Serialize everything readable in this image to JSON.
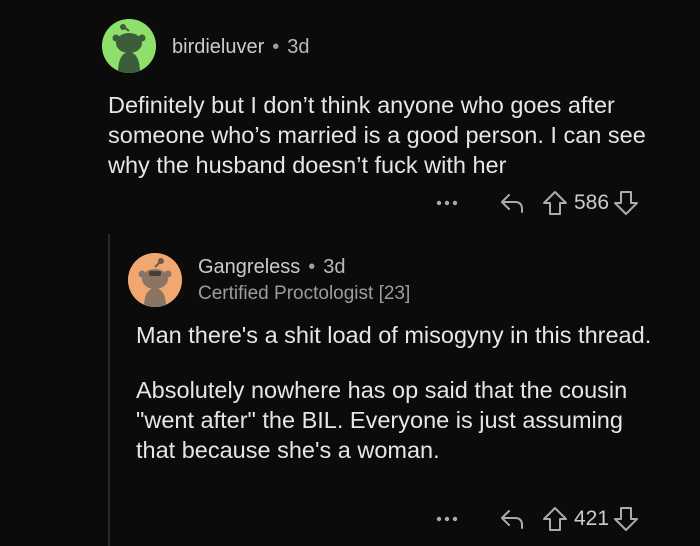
{
  "comments": [
    {
      "username": "birdieluver",
      "age": "3d",
      "flair": "",
      "paragraphs": [
        "Definitely but I don’t think anyone who goes after someone who’s married is a good person. I can see why the husband doesn’t fuck with her"
      ],
      "score": "586",
      "avatar_color": "#8ee06a",
      "more_icon": "more-dots-icon",
      "reply_icon": "reply-arrow-icon",
      "upvote_icon": "upvote-arrow-icon",
      "downvote_icon": "downvote-arrow-icon"
    },
    {
      "username": "Gangreless",
      "age": "3d",
      "flair": "Certified Proctologist [23]",
      "paragraphs": [
        "Man there's a shit load of misogyny in this thread.",
        "Absolutely nowhere has op said that the cousin \"went after\" the BIL. Everyone is just assuming that because she's a woman."
      ],
      "score": "421",
      "avatar_color": "#f0a870",
      "more_icon": "more-dots-icon",
      "reply_icon": "reply-arrow-icon",
      "upvote_icon": "upvote-arrow-icon",
      "downvote_icon": "downvote-arrow-icon"
    }
  ],
  "separator": "•"
}
